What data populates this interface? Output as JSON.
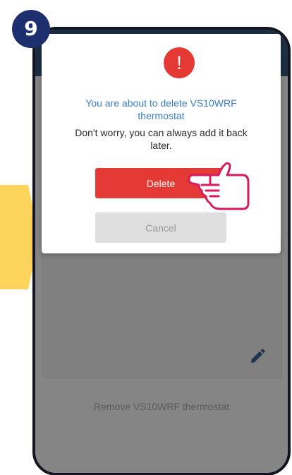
{
  "step": {
    "number": "9"
  },
  "dialog": {
    "alert_icon": "!",
    "title": "You are about to delete VS10WRF thermostat",
    "message": "Don't worry, you can always add it back later.",
    "delete_label": "Delete",
    "cancel_label": "Cancel"
  },
  "background": {
    "remove_label": "Remove VS10WRF thermostat"
  },
  "icons": {
    "alert": "exclamation-icon",
    "edit": "pencil-icon",
    "pointer": "pointing-hand-icon",
    "arrow": "yellow-arrow-icon"
  },
  "colors": {
    "danger": "#e53935",
    "title_blue": "#3a7fc9",
    "badge_navy": "#1d2f6f",
    "hand_magenta": "#d81b60",
    "arrow_yellow": "#fdd55c",
    "overlay_gray": "#858585"
  }
}
